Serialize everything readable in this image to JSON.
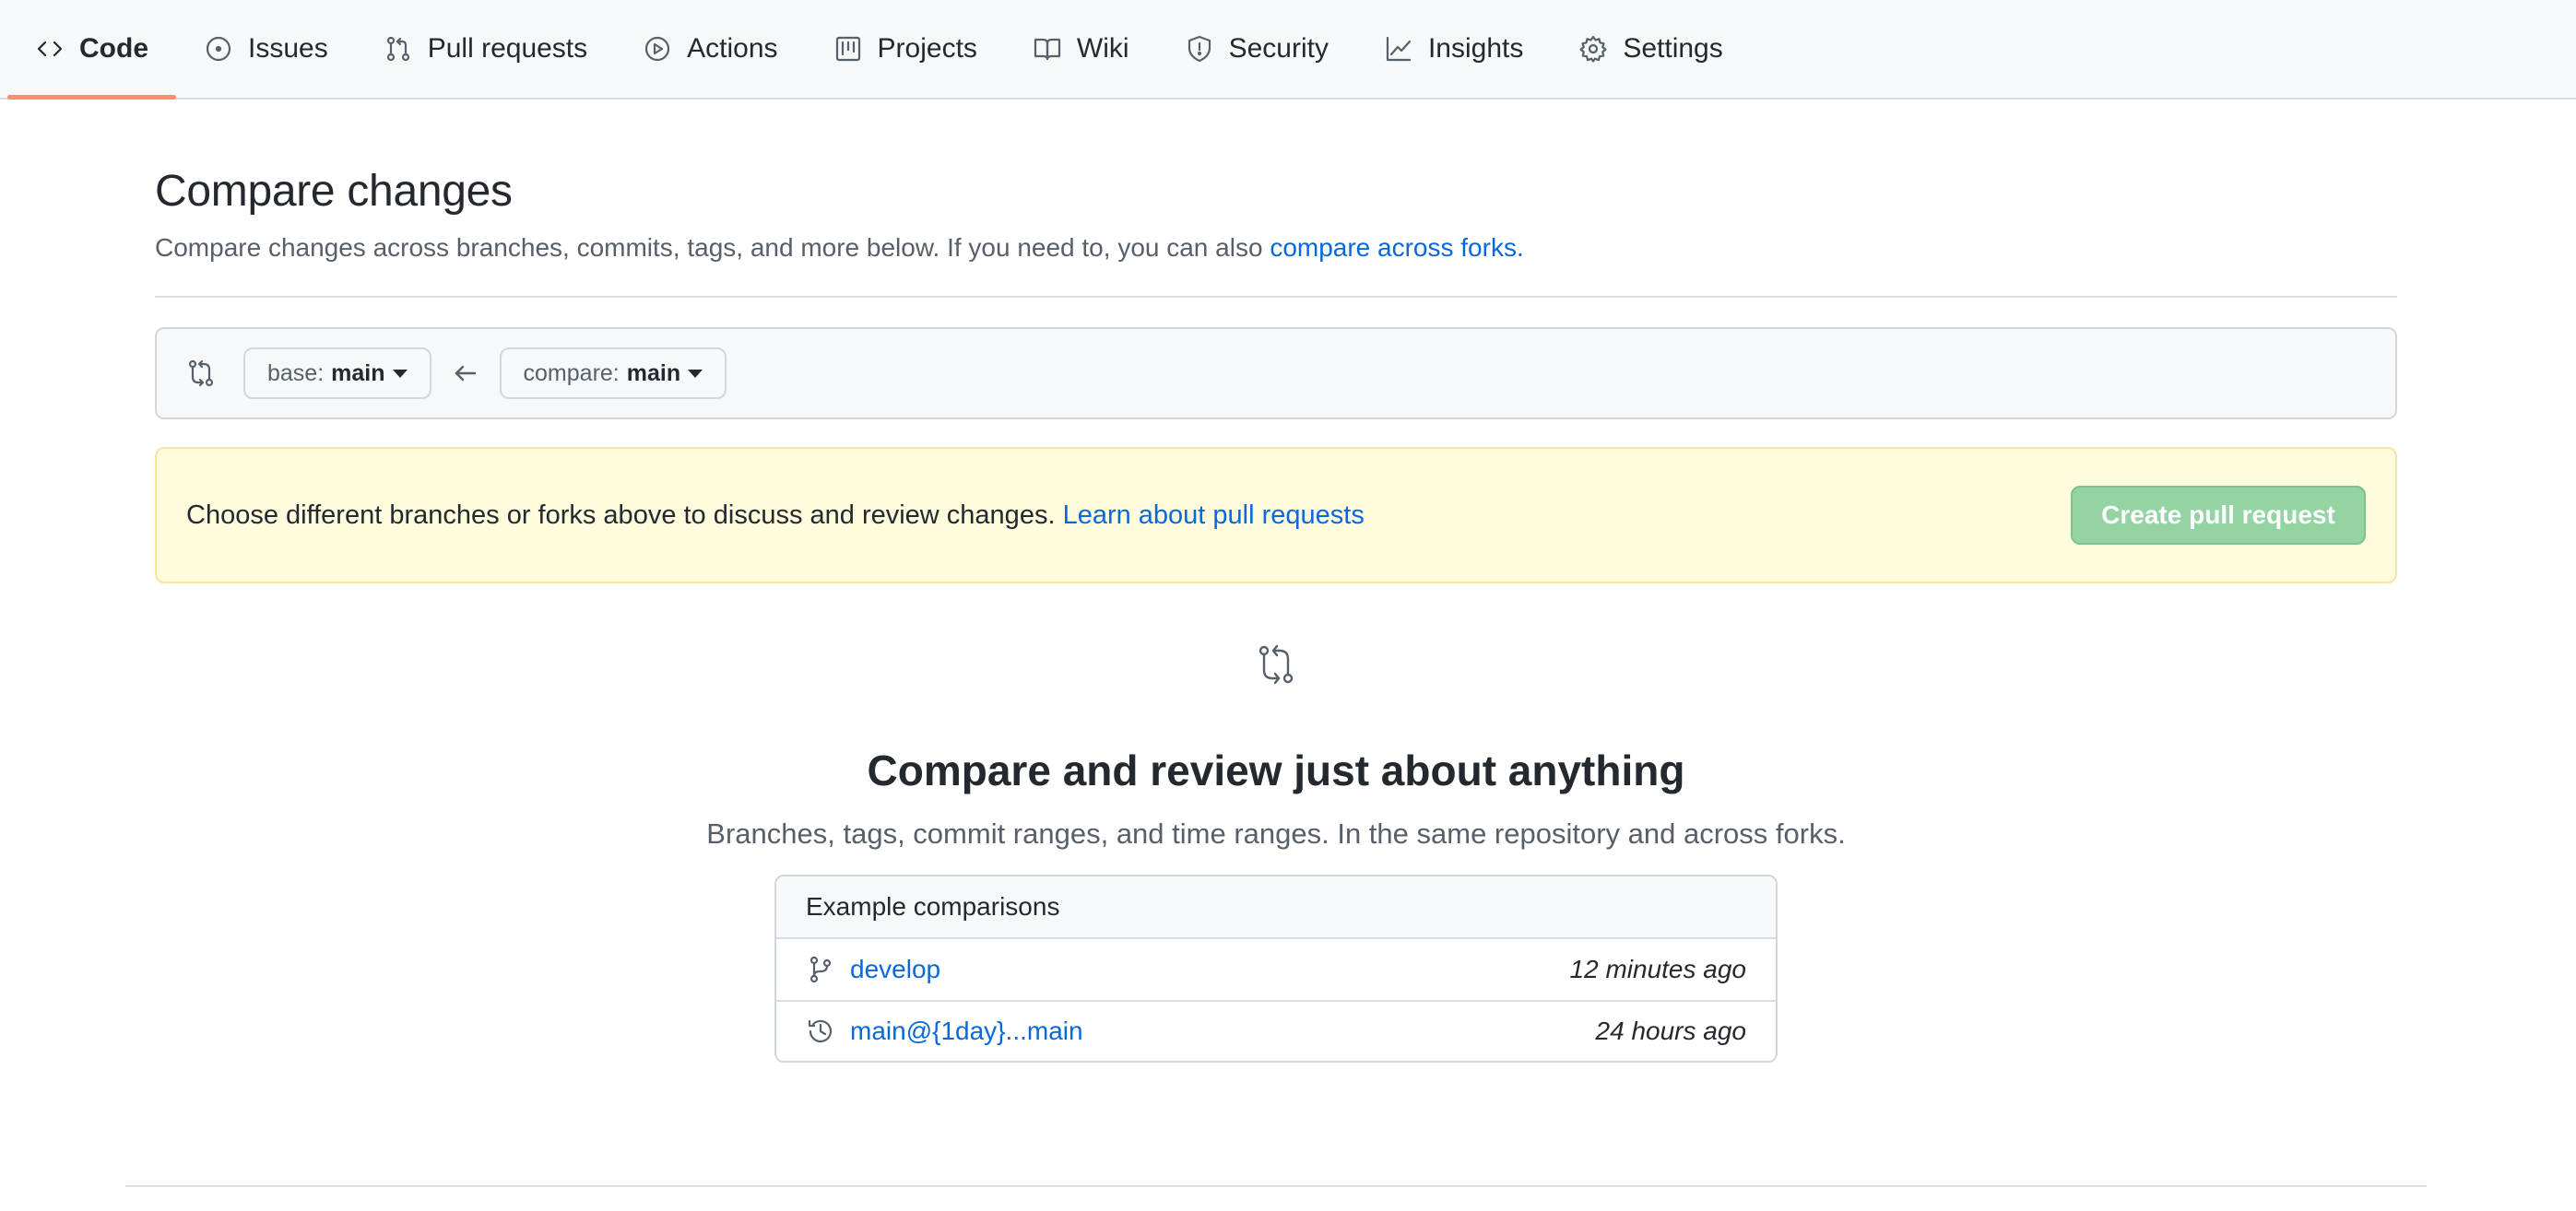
{
  "nav": {
    "tabs": [
      {
        "label": "Code",
        "icon": "code-icon",
        "active": true
      },
      {
        "label": "Issues",
        "icon": "issue-icon"
      },
      {
        "label": "Pull requests",
        "icon": "pull-request-icon"
      },
      {
        "label": "Actions",
        "icon": "play-icon"
      },
      {
        "label": "Projects",
        "icon": "project-icon"
      },
      {
        "label": "Wiki",
        "icon": "book-icon"
      },
      {
        "label": "Security",
        "icon": "shield-icon"
      },
      {
        "label": "Insights",
        "icon": "graph-icon"
      },
      {
        "label": "Settings",
        "icon": "gear-icon"
      }
    ]
  },
  "page": {
    "title": "Compare changes",
    "subtitle_text": "Compare changes across branches, commits, tags, and more below. If you need to, you can also ",
    "subtitle_link": "compare across forks."
  },
  "range": {
    "base_label": "base:",
    "base_branch": "main",
    "compare_label": "compare:",
    "compare_branch": "main"
  },
  "flash": {
    "text": "Choose different branches or forks above to discuss and review changes. ",
    "link": "Learn about pull requests",
    "button": "Create pull request"
  },
  "blankslate": {
    "title": "Compare and review just about anything",
    "subtitle": "Branches, tags, commit ranges, and time ranges. In the same repository and across forks."
  },
  "examples": {
    "header": "Example comparisons",
    "rows": [
      {
        "icon": "git-branch-icon",
        "name": "develop",
        "time": "12 minutes ago"
      },
      {
        "icon": "history-icon",
        "name": "main@{1day}...main",
        "time": "24 hours ago"
      }
    ]
  },
  "colors": {
    "link": "#0969da",
    "active_tab_underline": "#fd8c73",
    "flash_bg": "#fffbdd",
    "button_disabled": "#94d3a2"
  }
}
